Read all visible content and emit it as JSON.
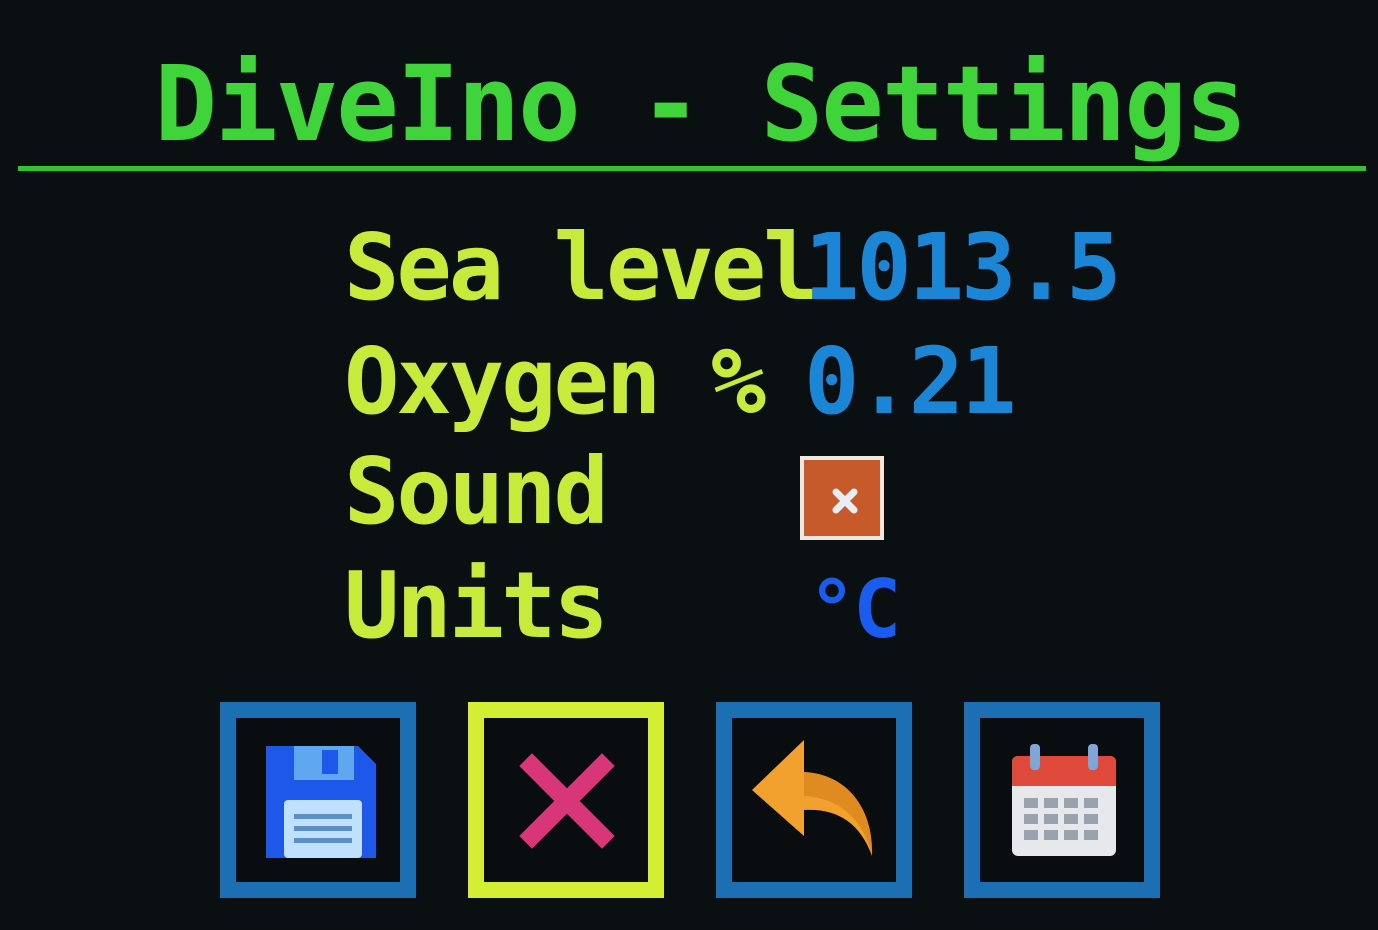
{
  "app": {
    "title": "DiveIno - Settings"
  },
  "settings": {
    "sea_level": {
      "label": "Sea level",
      "value": "1013.5"
    },
    "oxygen": {
      "label": "Oxygen %",
      "value": "0.21"
    },
    "sound": {
      "label": "Sound",
      "checked": false
    },
    "units": {
      "label": "Units",
      "value": "°C"
    }
  },
  "toolbar": {
    "buttons": [
      {
        "icon": "floppy-disk-icon",
        "state": "normal"
      },
      {
        "icon": "close-x-icon",
        "state": "selected"
      },
      {
        "icon": "back-arrow-icon",
        "state": "normal"
      },
      {
        "icon": "calendar-icon",
        "state": "normal"
      }
    ]
  },
  "colors": {
    "title": "#3ed43a",
    "label": "#c8ea3a",
    "value": "#1c86d6",
    "button_border": "#1d6fb4",
    "button_selected_border": "#d4ee33"
  }
}
